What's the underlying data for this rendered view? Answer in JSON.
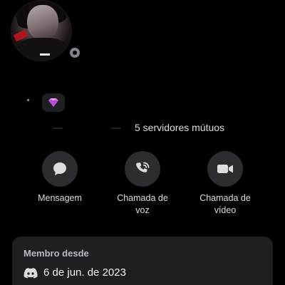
{
  "profile": {
    "avatar_icon": "user-photo",
    "status": "offline",
    "badge_icon": "nitro-gem-icon",
    "mutual_servers": "5 servidores mútuos"
  },
  "actions": [
    {
      "label": "Mensagem",
      "icon": "chat-bubble-icon"
    },
    {
      "label": "Chamada de\nvoz",
      "icon": "phone-call-icon"
    },
    {
      "label": "Chamada de\nvídeo",
      "icon": "video-camera-icon"
    }
  ],
  "member_since": {
    "title": "Membro desde",
    "date": "6 de jun. de 2023",
    "icon": "discord-logo-icon"
  },
  "colors": {
    "background": "#000000",
    "button_bg": "#2b2d31",
    "card_bg": "#1e1f22",
    "badge_pink": "#e26ef7",
    "status_offline": "#80848e"
  }
}
